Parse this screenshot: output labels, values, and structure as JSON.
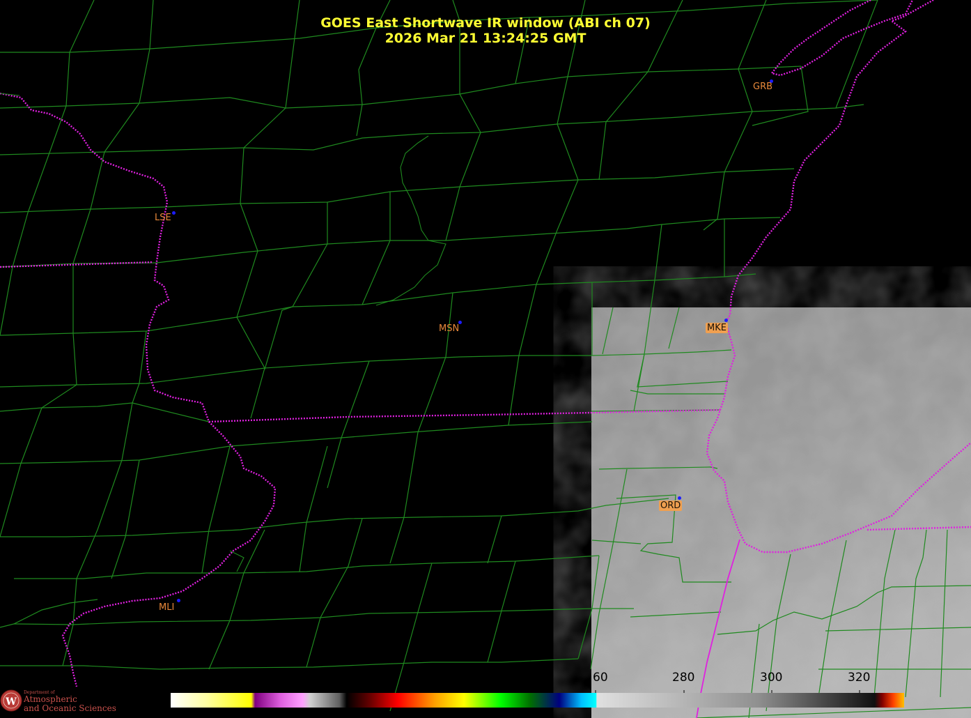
{
  "title": {
    "line1": "GOES East Shortwave IR window (ABI ch 07)",
    "line2": "2026 Mar 21  13:24:25 GMT"
  },
  "stations": [
    {
      "id": "GRB",
      "boxed": false
    },
    {
      "id": "LSE",
      "boxed": false
    },
    {
      "id": "MSN",
      "boxed": false
    },
    {
      "id": "MKE",
      "boxed": true
    },
    {
      "id": "ORD",
      "boxed": true
    },
    {
      "id": "MLI",
      "boxed": false
    }
  ],
  "colorbar": {
    "tick_labels": [
      "260",
      "280",
      "300",
      "320"
    ],
    "visible_tick_text": [
      "60",
      "280",
      "300",
      "320"
    ]
  },
  "logo": {
    "line_small": "Department of",
    "line1": "Atmospheric",
    "line2": "and Oceanic Sciences"
  },
  "colors": {
    "background": "#000000",
    "county_lines": "#1f8a1f",
    "state_lines": "#e020e0",
    "title": "#ffff33",
    "station_label": "#e8883a",
    "station_dot": "#1c1cff"
  }
}
